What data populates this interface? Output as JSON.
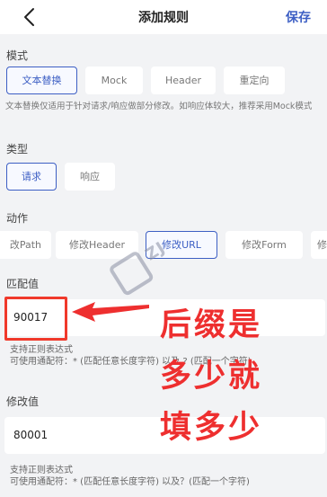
{
  "header": {
    "title": "添加规则",
    "save_label": "保存"
  },
  "mode": {
    "label": "模式",
    "options": [
      "文本替换",
      "Mock",
      "Header",
      "重定向"
    ],
    "selected": "文本替换",
    "description": "文本替换仅适用于针对请求/响应做部分修改。如响应体较大，推荐采用Mock模式"
  },
  "type": {
    "label": "类型",
    "options": [
      "请求",
      "响应"
    ],
    "selected": "请求"
  },
  "action": {
    "label": "动作",
    "options": [
      "改Path",
      "修改Header",
      "修改URL",
      "修改Form",
      "修"
    ],
    "selected": "修改URL"
  },
  "match": {
    "label": "匹配值",
    "value": "90017",
    "hint_line1": "支持正则表达式",
    "hint_line2": "可使用通配符：* (匹配任意长度字符) 以及 ? (匹配一个字符)"
  },
  "modify": {
    "label": "修改值",
    "value": "80001",
    "hint_line1": "支持正则表达式",
    "hint_line2": "可使用通配符：* (匹配任意长度字符) 以及？(匹配一个字符)"
  },
  "annotation": {
    "lines": [
      "后缀是",
      "多少就",
      "填多少"
    ],
    "color": "#ee2f2f"
  },
  "colors": {
    "accent": "#3d5fc4",
    "background": "#f2f3f5"
  }
}
